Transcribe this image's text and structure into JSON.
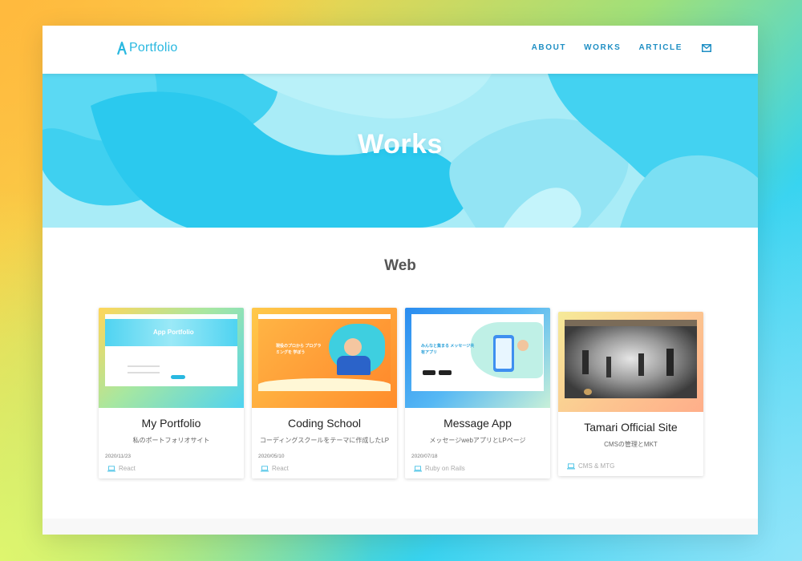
{
  "brand": {
    "name": "Portfolio"
  },
  "nav": {
    "about": "ABOUT",
    "works": "WORKS",
    "article": "ARTICLE",
    "contact_icon": "mail-icon"
  },
  "hero": {
    "title": "Works"
  },
  "section": {
    "title": "Web"
  },
  "cards": [
    {
      "title": "My Portfolio",
      "desc": "私のポートフォリオサイト",
      "date": "2020/11/23",
      "tag": "React",
      "thumb_text": "App Portfolio"
    },
    {
      "title": "Coding School",
      "desc": "コーディングスクールをテーマに作成したLP",
      "date": "2020/05/10",
      "tag": "React",
      "thumb_text": "現役のプロから プログラミングを 学ぼう"
    },
    {
      "title": "Message App",
      "desc": "メッセージwebアプリとLPページ",
      "date": "2020/07/18",
      "tag": "Ruby on Rails",
      "thumb_text": "みんなと集まる メッセージ共有アプリ"
    },
    {
      "title": "Tamari Official Site",
      "desc": "CMSの管理とMKT",
      "date": "",
      "tag": "CMS & MTG"
    }
  ],
  "colors": {
    "accent": "#29b8e0",
    "nav": "#1f8fc4",
    "hero": "#aeeef8"
  }
}
